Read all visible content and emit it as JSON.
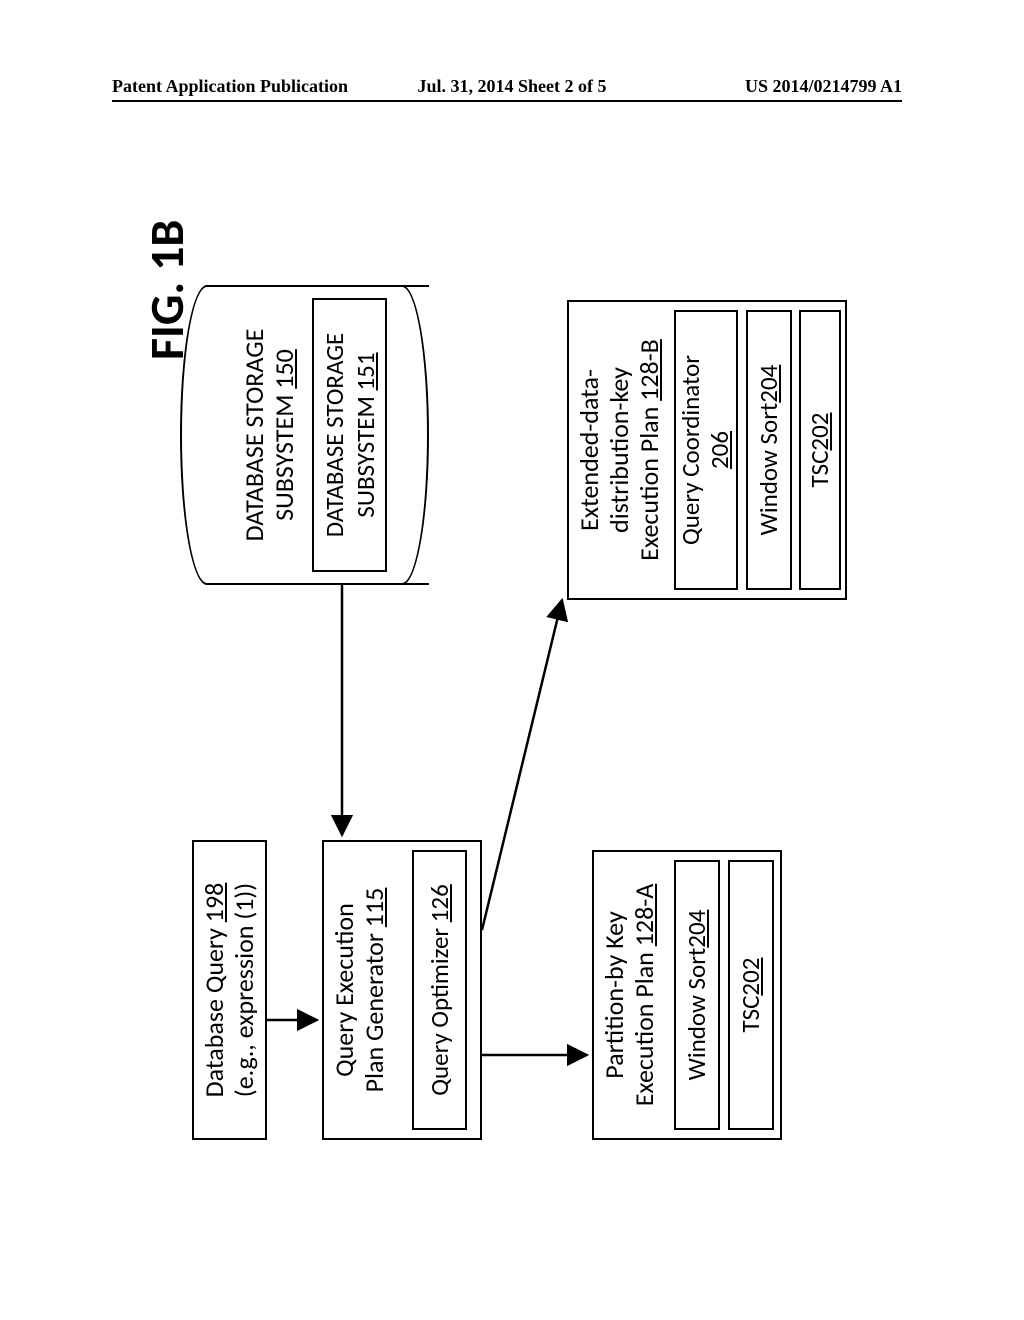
{
  "header": {
    "left": "Patent Application Publication",
    "center": "Jul. 31, 2014  Sheet 2 of 5",
    "right": "US 2014/0214799 A1"
  },
  "figure_label": "FIG. 1B",
  "query_box": {
    "line1": "Database Query ",
    "ref1": "198",
    "line2": "(e.g., expression (1))"
  },
  "plan_gen": {
    "line1": "Query Execution",
    "line2": "Plan Generator ",
    "ref": "115"
  },
  "optimizer": {
    "label": "Query Optimizer ",
    "ref": "126"
  },
  "storage1": {
    "line1": "DATABASE STORAGE",
    "line2": "SUBSYSTEM ",
    "ref": "150"
  },
  "storage2": {
    "line1": "DATABASE STORAGE",
    "line2": "SUBSYSTEM ",
    "ref": "151"
  },
  "planA": {
    "title1": "Partition-by Key",
    "title2": "Execution Plan ",
    "ref": "128-A",
    "window_sort": {
      "label": "Window Sort ",
      "ref": "204"
    },
    "tsc": {
      "label": "TSC ",
      "ref": "202"
    }
  },
  "planB": {
    "title1": "Extended-data-",
    "title2": "distribution-key",
    "title3": "Execution Plan ",
    "ref": "128-B",
    "coordinator": {
      "label": "Query Coordinator",
      "ref": "206"
    },
    "window_sort": {
      "label": "Window Sort ",
      "ref": "204"
    },
    "tsc": {
      "label": "TSC ",
      "ref": "202"
    }
  }
}
